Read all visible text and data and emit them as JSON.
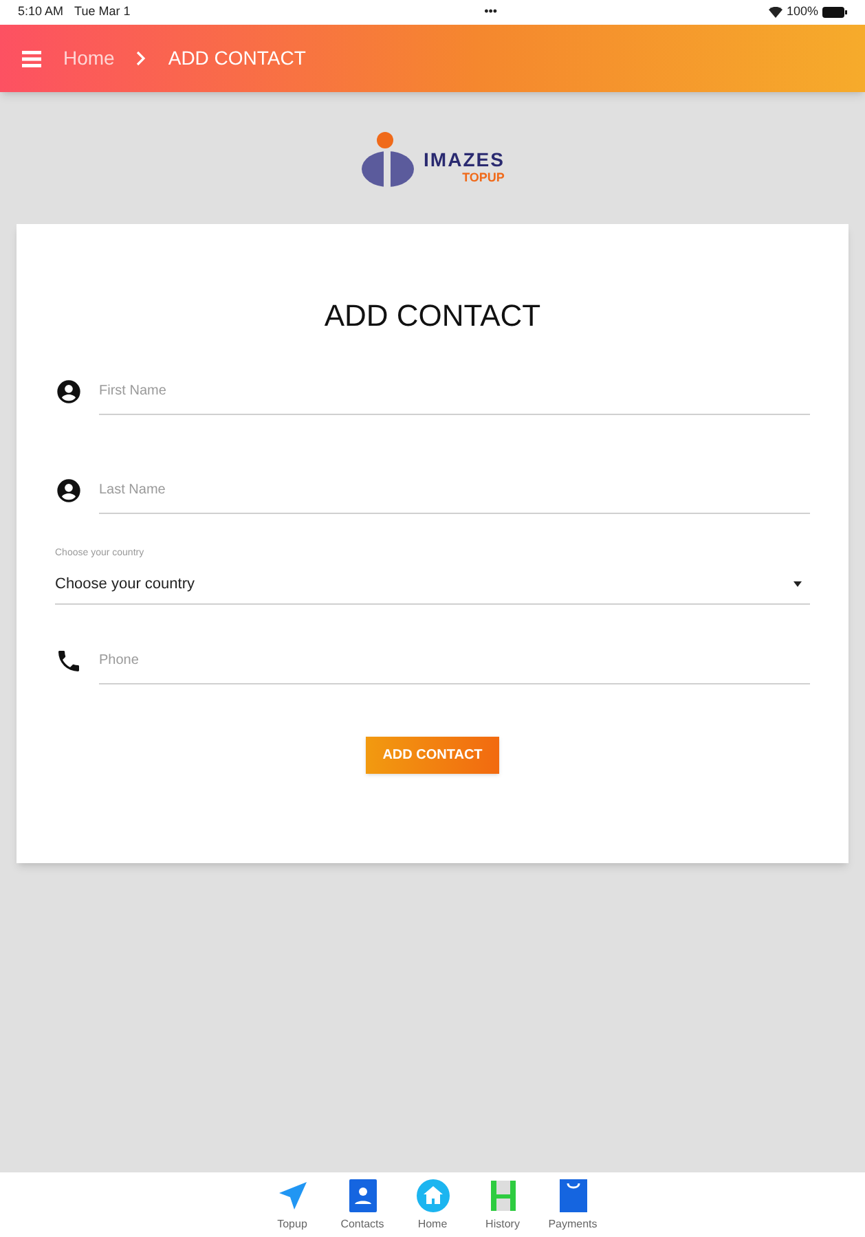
{
  "status_bar": {
    "time": "5:10 AM",
    "date": "Tue Mar 1",
    "dots": "•••",
    "battery": "100%"
  },
  "header": {
    "breadcrumb": [
      {
        "label": "Home",
        "selected": false
      },
      {
        "label": "ADD CONTACT",
        "selected": true
      }
    ]
  },
  "logo": {
    "name": "IMAZES",
    "tagline": "TOPUP"
  },
  "form": {
    "title": "ADD CONTACT",
    "fields": [
      {
        "kind": "name",
        "placeholder": "First Name"
      },
      {
        "kind": "name",
        "placeholder": "Last Name"
      },
      {
        "kind": "select",
        "label": "Choose your country",
        "value": "Choose your country"
      },
      {
        "kind": "phone",
        "placeholder": "Phone"
      }
    ],
    "submit": "ADD CONTACT"
  },
  "bottom_nav": [
    {
      "label": "Topup"
    },
    {
      "label": "Contacts"
    },
    {
      "label": "Home"
    },
    {
      "label": "History"
    },
    {
      "label": "Payments"
    }
  ]
}
